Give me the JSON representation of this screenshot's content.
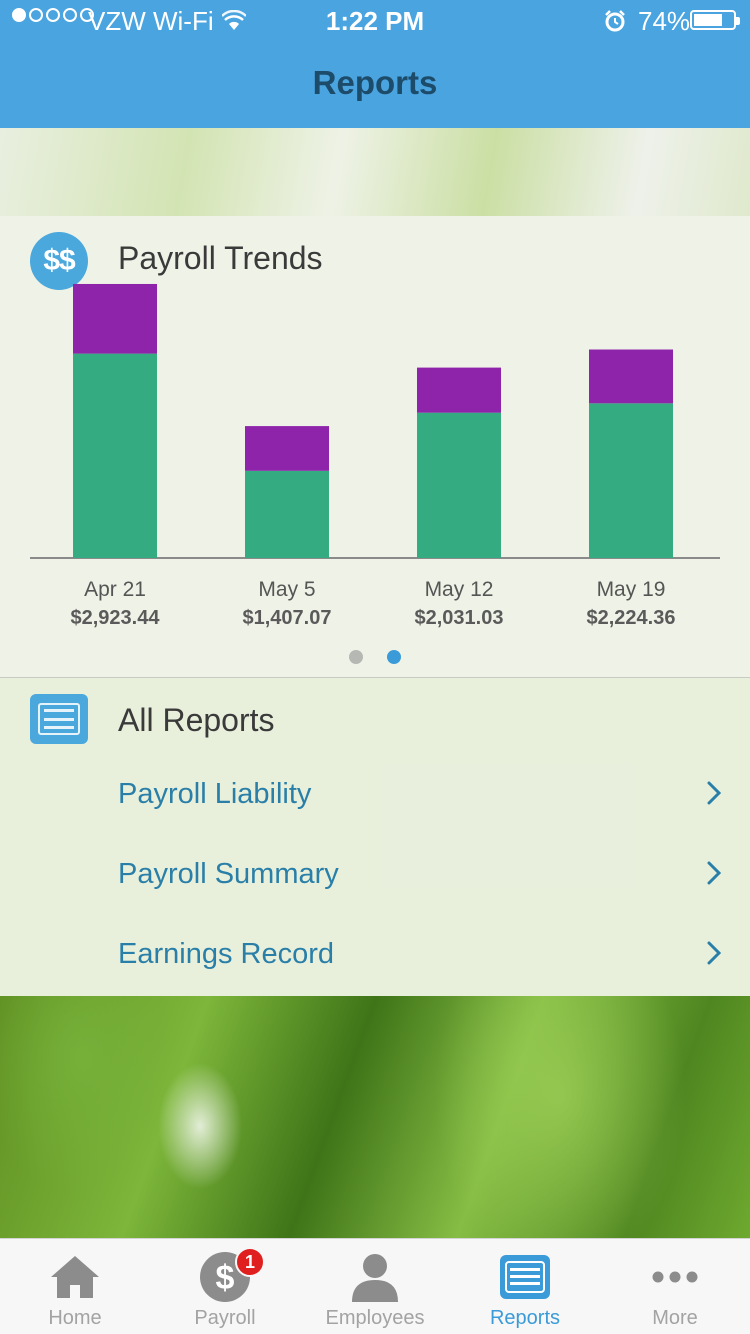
{
  "status_bar": {
    "carrier": "VZW Wi-Fi",
    "time": "1:22 PM",
    "battery": "74%",
    "battery_level": 0.74
  },
  "nav": {
    "title": "Reports"
  },
  "trends": {
    "icon_text": "$$",
    "title": "Payroll Trends",
    "pager": {
      "pages": 2,
      "current": 2
    }
  },
  "chart_data": {
    "type": "bar",
    "stacked": true,
    "categories": [
      "Apr 21",
      "May 5",
      "May 12",
      "May 19"
    ],
    "totals": [
      "$2,923.44",
      "$1,407.07",
      "$2,031.03",
      "$2,224.36"
    ],
    "total_values": [
      2923.44,
      1407.07,
      2031.03,
      2224.36
    ],
    "series": [
      {
        "color": "#35ab82",
        "values": [
          2180,
          930,
          1550,
          1650
        ]
      },
      {
        "color": "#8e24aa",
        "values": [
          743,
          477,
          481,
          574
        ]
      }
    ],
    "ylim": [
      0,
      3200
    ],
    "grid": false,
    "legend": "none"
  },
  "all_reports": {
    "title": "All Reports",
    "items": [
      {
        "label": "Payroll Liability"
      },
      {
        "label": "Payroll Summary"
      },
      {
        "label": "Earnings Record"
      }
    ]
  },
  "tab_bar": {
    "tabs": [
      {
        "label": "Home",
        "icon": "home-icon"
      },
      {
        "label": "Payroll",
        "icon": "dollar-icon",
        "badge": "1"
      },
      {
        "label": "Employees",
        "icon": "person-icon"
      },
      {
        "label": "Reports",
        "icon": "reports-icon",
        "active": true
      },
      {
        "label": "More",
        "icon": "more-icon"
      }
    ]
  }
}
